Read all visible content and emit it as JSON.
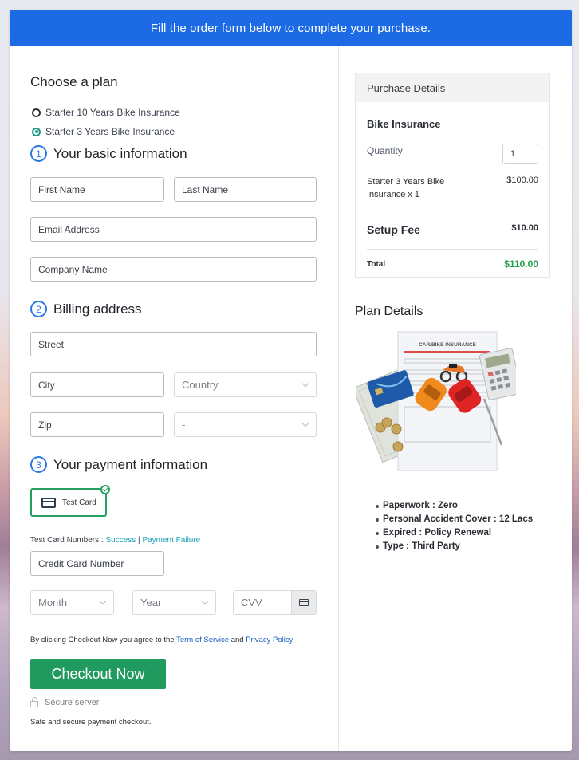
{
  "banner": {
    "text": "Fill the order form below to complete your purchase."
  },
  "plan": {
    "title": "Choose a plan",
    "options": [
      {
        "label": "Starter 10 Years Bike Insurance",
        "selected": false
      },
      {
        "label": "Starter 3 Years Bike Insurance",
        "selected": true
      }
    ]
  },
  "basic": {
    "step": "1",
    "title": "Your basic information",
    "first_name": "First Name",
    "last_name": "Last Name",
    "email": "Email Address",
    "company": "Company Name"
  },
  "billing": {
    "step": "2",
    "title": "Billing address",
    "street": "Street",
    "city": "City",
    "country": "Country",
    "zip": "Zip",
    "state": "-"
  },
  "payment": {
    "step": "3",
    "title": "Your payment information",
    "method_label": "Test Card",
    "test_numbers_label": "Test Card Numbers : ",
    "success_link": "Success",
    "separator": " | ",
    "failure_link": "Payment Failure",
    "card_number": "Credit Card Number",
    "month": "Month",
    "year": "Year",
    "cvv": "CVV"
  },
  "agreement": {
    "prefix": "By clicking Checkout Now you agree to the ",
    "terms": "Term of Service",
    "and": " and ",
    "privacy": "Privacy Policy"
  },
  "checkout": {
    "button": "Checkout Now",
    "secure": "Secure server",
    "safe": "Safe and secure payment checkout."
  },
  "purchase": {
    "title": "Purchase Details",
    "product": "Bike Insurance",
    "quantity_label": "Quantity",
    "quantity": "1",
    "line_desc": "Starter 3 Years Bike Insurance x 1",
    "line_price": "$100.00",
    "setup_fee_label": "Setup Fee",
    "setup_fee": "$10.00",
    "total_label": "Total",
    "total": "$110.00",
    "total_color": "#22a04e"
  },
  "plan_details": {
    "title": "Plan Details",
    "image_caption": "CAR/BIKE INSURANCE",
    "features": [
      "Paperwork : Zero",
      "Personal Accident Cover : 12 Lacs",
      "Expired : Policy Renewal",
      "Type : Third Party"
    ]
  },
  "colors": {
    "brand_blue": "#1d6ae5",
    "checkout_green": "#219a60",
    "radio_teal": "#1d9a82"
  }
}
